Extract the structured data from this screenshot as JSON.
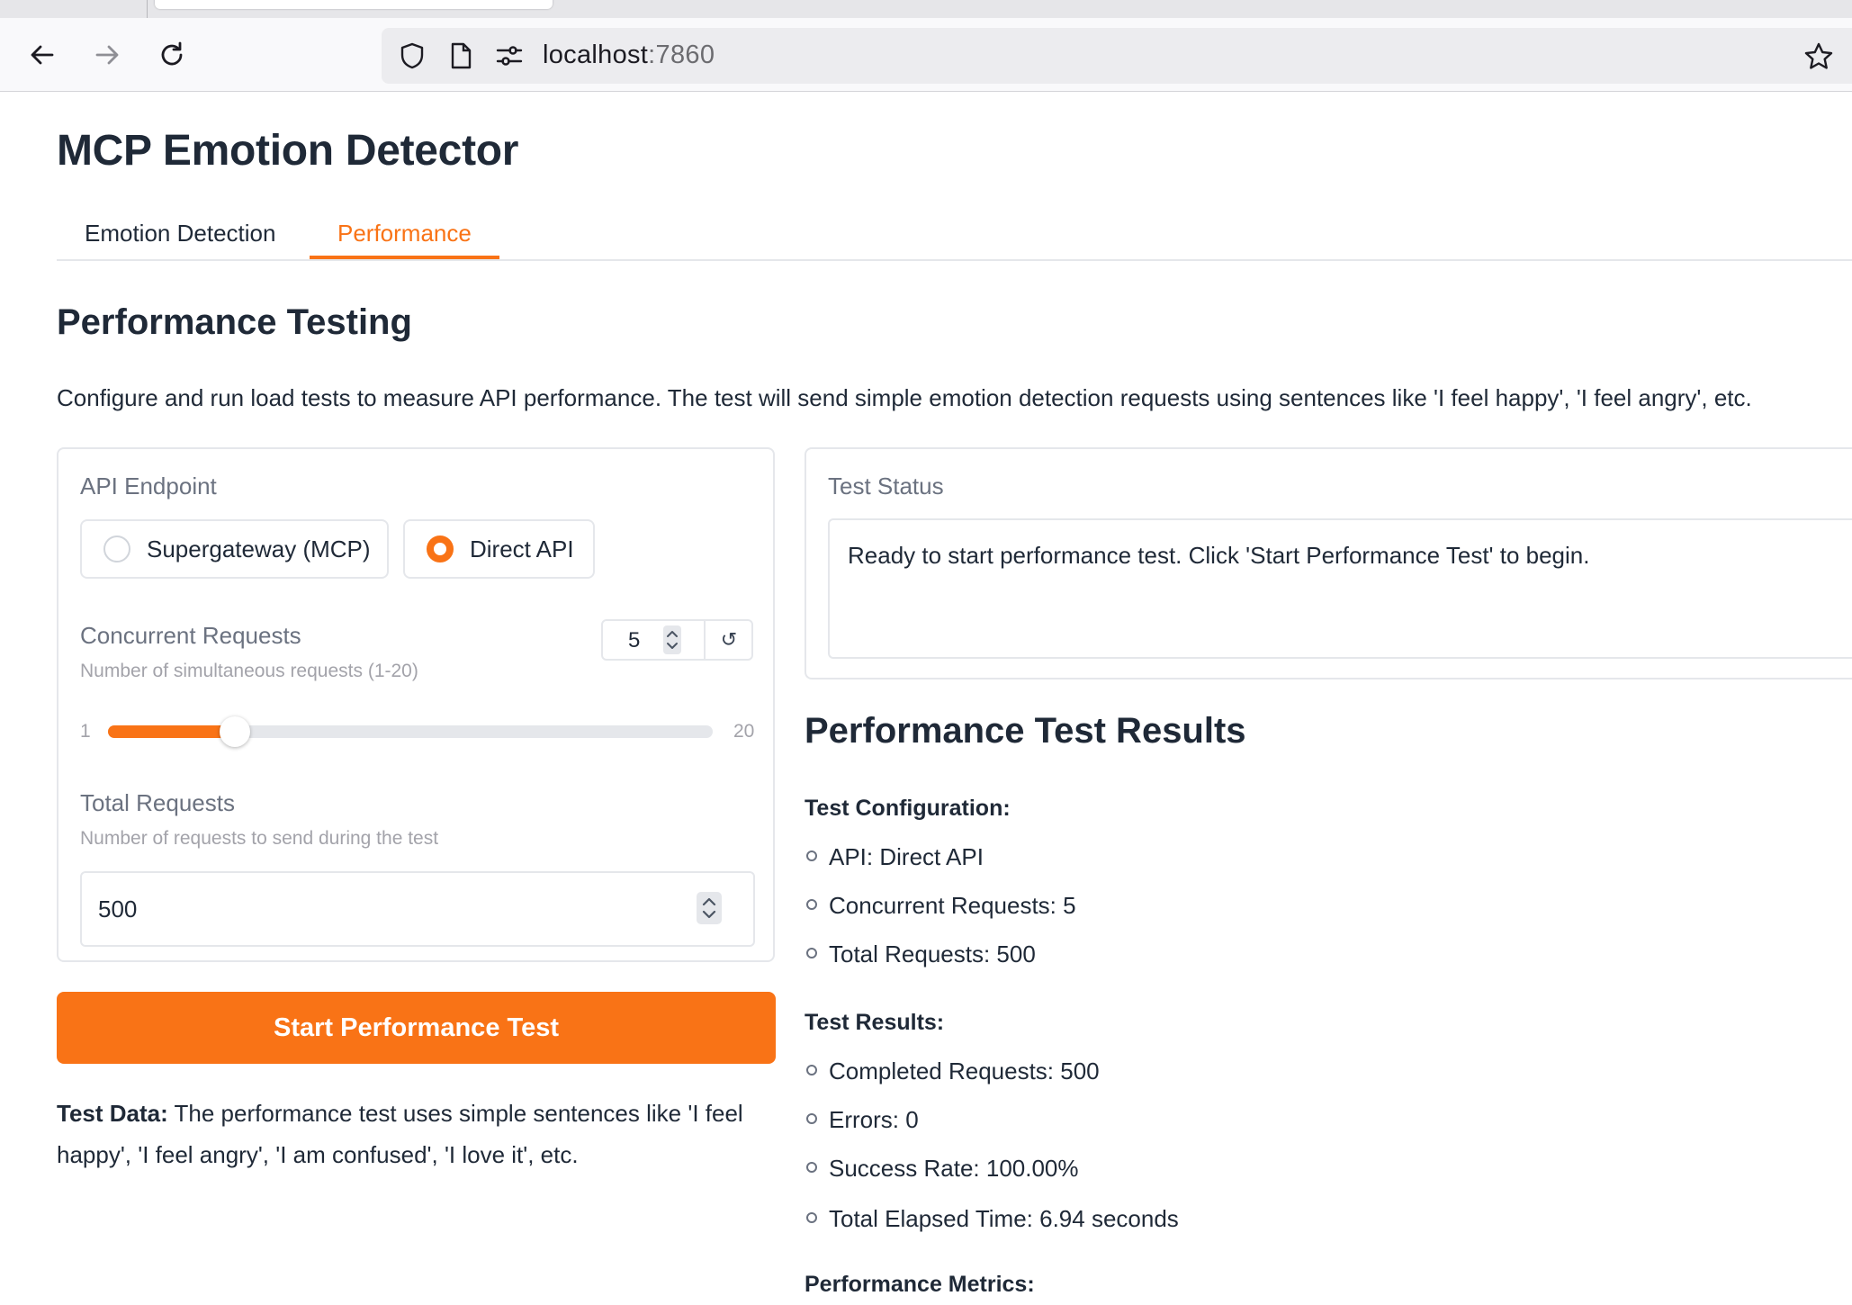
{
  "browser": {
    "url_host": "localhost",
    "url_port": ":7860",
    "icons": [
      "back-arrow-icon",
      "forward-arrow-icon",
      "reload-icon",
      "shield-icon",
      "page-icon",
      "permissions-icon",
      "bookmark-star-icon"
    ]
  },
  "app": {
    "title": "MCP Emotion Detector",
    "accent_color": "#f97316",
    "tabs": [
      {
        "label": "Emotion Detection",
        "selected": false
      },
      {
        "label": "Performance",
        "selected": true
      }
    ]
  },
  "performance": {
    "section_title": "Performance Testing",
    "description": "Configure and run load tests to measure API performance. The test will send simple emotion detection requests using sentences like 'I feel happy', 'I feel angry', etc.",
    "api_endpoint": {
      "label": "API Endpoint",
      "options": [
        {
          "label": "Supergateway (MCP)",
          "selected": false
        },
        {
          "label": "Direct API",
          "selected": true
        }
      ]
    },
    "concurrent": {
      "label": "Concurrent Requests",
      "info": "Number of simultaneous requests (1-20)",
      "value": "5",
      "min": "1",
      "max": "20",
      "numeric_value": 5,
      "range_min": 1,
      "range_max": 20,
      "reset_glyph": "↺"
    },
    "total": {
      "label": "Total Requests",
      "info": "Number of requests to send during the test",
      "value": "500"
    },
    "start_button": "Start Performance Test",
    "test_data_bold": "Test Data:",
    "test_data_text": " The performance test uses simple sentences like 'I feel happy', 'I feel angry', 'I am confused', 'I love it', etc."
  },
  "status": {
    "label": "Test Status",
    "text": "Ready to start performance test. Click 'Start Performance Test' to begin."
  },
  "results": {
    "title": "Performance Test Results",
    "config_heading": "Test Configuration:",
    "config_items": [
      "API: Direct API",
      "Concurrent Requests: 5",
      "Total Requests: 500"
    ],
    "results_heading": "Test Results:",
    "result_items": [
      "Completed Requests: 500",
      "Errors: 0",
      "Success Rate: 100.00%",
      "Total Elapsed Time: 6.94 seconds"
    ],
    "metrics_heading": "Performance Metrics:"
  }
}
